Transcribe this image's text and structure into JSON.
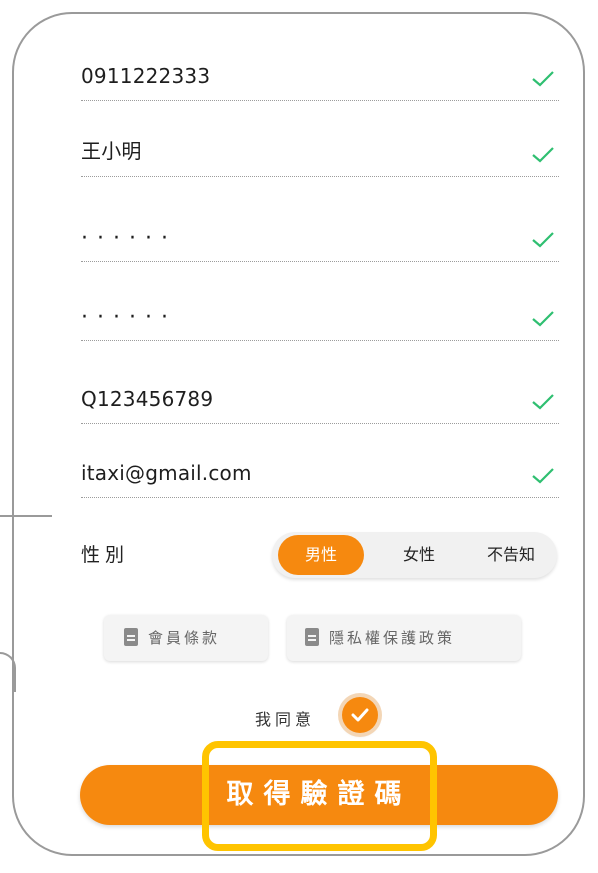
{
  "form": {
    "fields": [
      {
        "name": "phone",
        "value": "0911222333",
        "valid": true
      },
      {
        "name": "name",
        "value": "王小明",
        "valid": true
      },
      {
        "name": "password",
        "value": "······",
        "valid": true
      },
      {
        "name": "password-confirm",
        "value": "······",
        "valid": true
      },
      {
        "name": "id-number",
        "value": "Q123456789",
        "valid": true
      },
      {
        "name": "email",
        "value": "itaxi@gmail.com",
        "valid": true
      }
    ],
    "gender": {
      "label": "性別",
      "options": [
        "男性",
        "女性",
        "不告知"
      ],
      "selected": "男性"
    },
    "docs": {
      "terms_label": "會員條款",
      "privacy_label": "隱私權保護政策"
    },
    "agree": {
      "label": "我同意",
      "checked": true
    },
    "submit_label": "取得驗證碼"
  },
  "colors": {
    "accent": "#f6890f",
    "check": "#2fbf71",
    "highlight": "#ffc400"
  },
  "icons": {
    "valid": "check-icon",
    "document": "document-icon",
    "agree": "checkmark-circle-icon"
  }
}
